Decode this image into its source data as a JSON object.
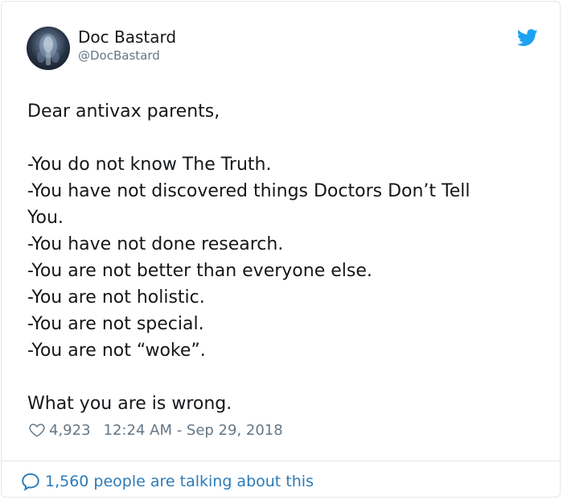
{
  "author": {
    "display_name": "Doc Bastard",
    "handle": "@DocBastard",
    "avatar_icon": "xray-avatar",
    "brand_icon": "twitter-bird-icon",
    "brand_color": "#1da1f2"
  },
  "tweet": {
    "lines": [
      "Dear antivax parents,",
      "",
      "-You do not know The Truth.",
      "-You have not discovered things Doctors Don’t Tell",
      "You.",
      "-You have not done research.",
      "-You are not better than everyone else.",
      "-You are not holistic.",
      "-You are not special.",
      "-You are not “woke”.",
      "",
      "What you are is wrong."
    ]
  },
  "meta": {
    "likes": "4,923",
    "timestamp": "12:24 AM - Sep 29, 2018",
    "heart_icon": "heart-icon"
  },
  "footer": {
    "talking_label": "1,560 people are talking about this",
    "icon": "speech-bubble-icon",
    "link_color": "#2b7bb9"
  }
}
